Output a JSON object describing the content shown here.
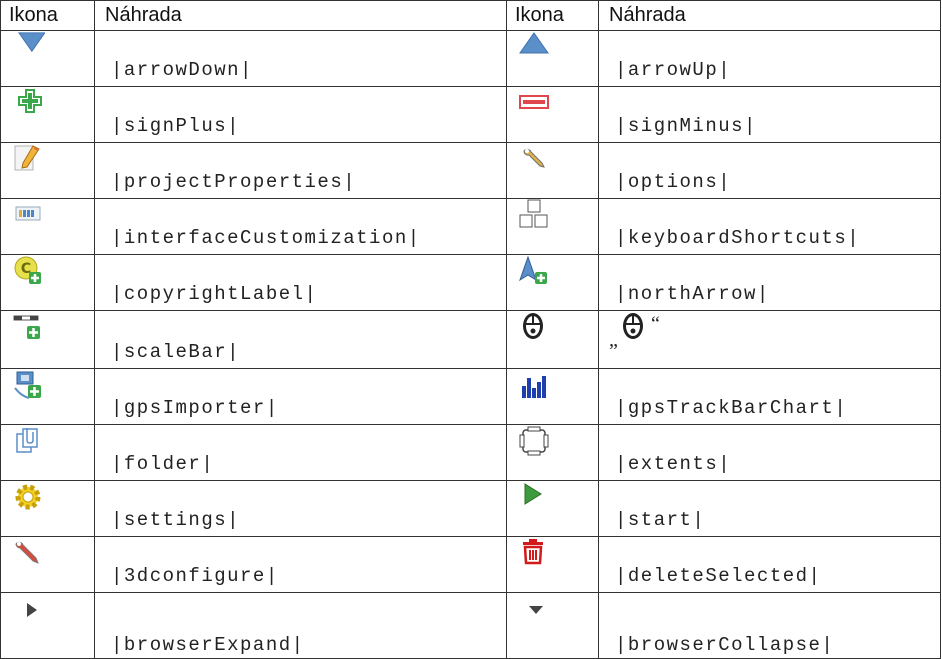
{
  "headers": [
    "Ikona",
    "Náhrada",
    "Ikona",
    "Náhrada"
  ],
  "rows": [
    {
      "left_icon": "arrow-down-icon",
      "left_text": "|arrowDown|",
      "right_icon": "arrow-up-icon",
      "right_text": "|arrowUp|"
    },
    {
      "left_icon": "sign-plus-icon",
      "left_text": "|signPlus|",
      "right_icon": "sign-minus-icon",
      "right_text": "|signMinus|"
    },
    {
      "left_icon": "project-properties-icon",
      "left_text": "|projectProperties|",
      "right_icon": "options-icon",
      "right_text": "|options|"
    },
    {
      "left_icon": "interface-customization-icon",
      "left_text": "|interfaceCustomization|",
      "right_icon": "keyboard-shortcuts-icon",
      "right_text": "|keyboardShortcuts|"
    },
    {
      "left_icon": "copyright-label-icon",
      "left_text": "|copyrightLabel|",
      "right_icon": "north-arrow-icon",
      "right_text": "|northArrow|"
    },
    {
      "left_icon": "scale-bar-icon",
      "left_text": "|scaleBar|",
      "right_icon": "mouse-icon",
      "right_text": "„"
    },
    {
      "left_icon": "gps-importer-icon",
      "left_text": "|gpsImporter|",
      "right_icon": "gps-track-bar-chart-icon",
      "right_text": "|gpsTrackBarChart|"
    },
    {
      "left_icon": "folder-icon",
      "left_text": "|folder|",
      "right_icon": "extents-icon",
      "right_text": "|extents|"
    },
    {
      "left_icon": "settings-icon",
      "left_text": "|settings|",
      "right_icon": "start-icon",
      "right_text": "|start|"
    },
    {
      "left_icon": "3d-configure-icon",
      "left_text": "|3dconfigure|",
      "right_icon": "delete-selected-icon",
      "right_text": "|deleteSelected|"
    },
    {
      "left_icon": "browser-expand-icon",
      "left_text": "|browserExpand|",
      "right_icon": "browser-collapse-icon",
      "right_text": "|browserCollapse|"
    }
  ],
  "mouse_row_quote_close": "“",
  "colors": {
    "border": "#333333",
    "text": "#222222",
    "arrow_blue": "#5b8fc9",
    "plus_green": "#3aa84a",
    "minus_red": "#e0474c",
    "delete_red": "#d11a1a",
    "start_green": "#3d9b3d"
  }
}
